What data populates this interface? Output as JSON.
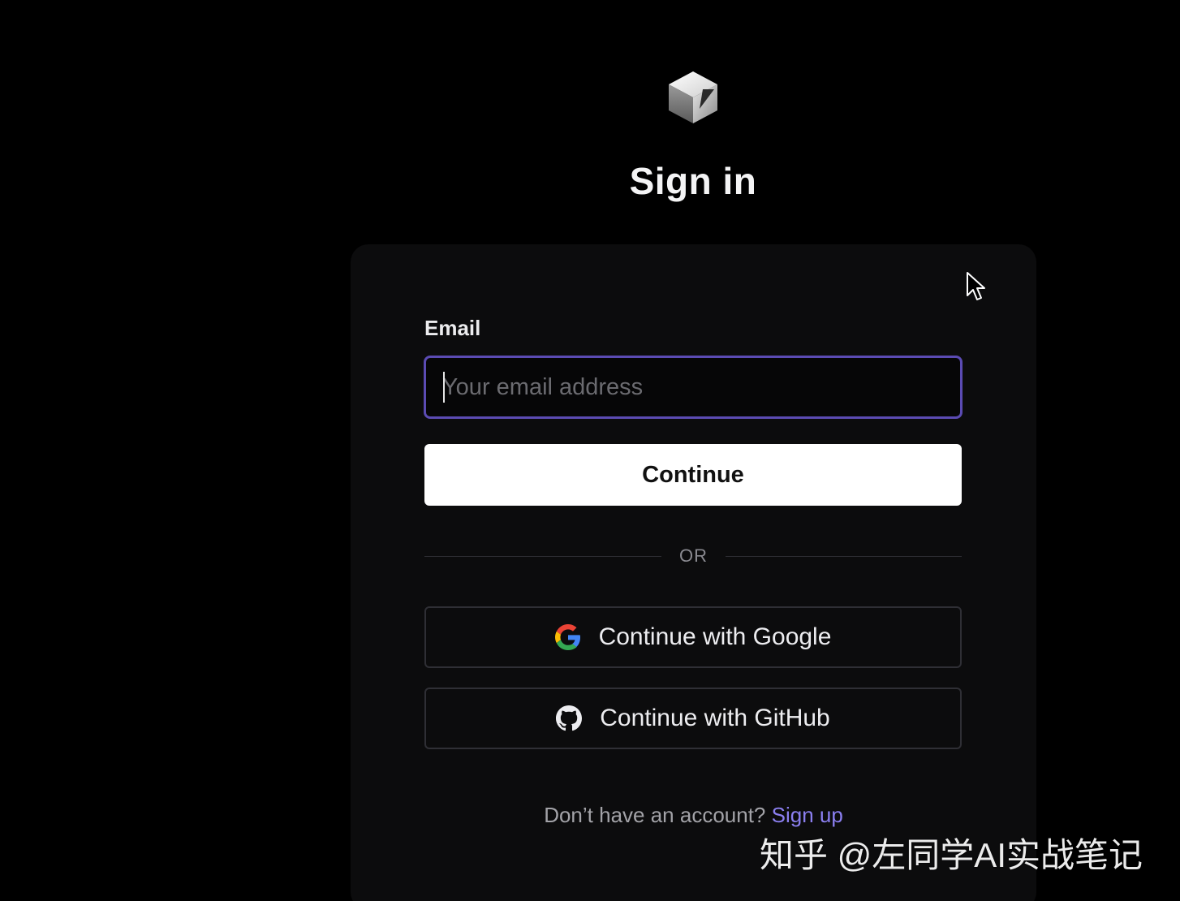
{
  "header": {
    "logo_icon": "cube-logo-icon",
    "title": "Sign in"
  },
  "form": {
    "email_label": "Email",
    "email_placeholder": "Your email address",
    "email_value": "",
    "continue_label": "Continue",
    "divider_text": "OR"
  },
  "oauth": {
    "google_label": "Continue with Google",
    "google_icon": "google-icon",
    "github_label": "Continue with GitHub",
    "github_icon": "github-icon"
  },
  "footer": {
    "prompt": "Don’t have an account?",
    "signup_label": "Sign up"
  },
  "watermark": {
    "text": "知乎 @左同学AI实战笔记"
  },
  "colors": {
    "background": "#000000",
    "card": "#0c0c0d",
    "input_focus_border": "#5b4bb3",
    "link": "#8b7ff0",
    "primary_button": "#ffffff"
  }
}
